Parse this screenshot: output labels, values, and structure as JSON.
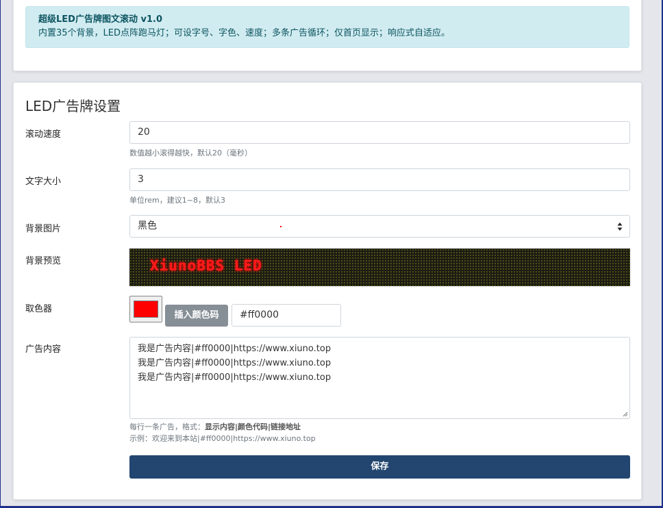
{
  "plugin_info": {
    "title": "超级LED广告牌图文滚动 v1.0",
    "description": "内置35个背景，LED点阵跑马灯；可设字号、字色、速度；多条广告循环；仅首页显示；响应式自适应。"
  },
  "settings": {
    "heading": "LED广告牌设置",
    "speed": {
      "label": "滚动速度",
      "value": "20",
      "help": "数值越小滚得越快，默认20（毫秒）"
    },
    "font_size": {
      "label": "文字大小",
      "value": "3",
      "help": "单位rem，建议1~8，默认3"
    },
    "background": {
      "label": "背景图片",
      "selected": "黑色"
    },
    "preview": {
      "label": "背景预览",
      "led_text": "XiunoBBS LED"
    },
    "color_picker": {
      "label": "取色器",
      "color": "#ff0000",
      "insert_button": "插入颜色码",
      "value": "#ff0000"
    },
    "ad_content": {
      "label": "广告内容",
      "lines": [
        "我是广告内容|#ff0000|https://www.xiuno.top",
        "我是广告内容|#ff0000|https://www.xiuno.top",
        "我是广告内容|#ff0000|https://www.xiuno.top"
      ],
      "help_prefix": "每行一条广告，格式：",
      "help_format": "显示内容|颜色代码|链接地址",
      "help_example": "示例：欢迎来到本站|#ff0000|https://www.xiuno.top"
    },
    "save_button": "保存"
  },
  "icons": {
    "select_arrow": "up-down-caret-icon",
    "resize": "resize-grip-icon"
  },
  "colors": {
    "accent": "#22466f",
    "alert_bg": "#d1ecf1",
    "alert_text": "#0c5460",
    "led_text": "#ff0000",
    "secondary_button": "#868e96"
  }
}
